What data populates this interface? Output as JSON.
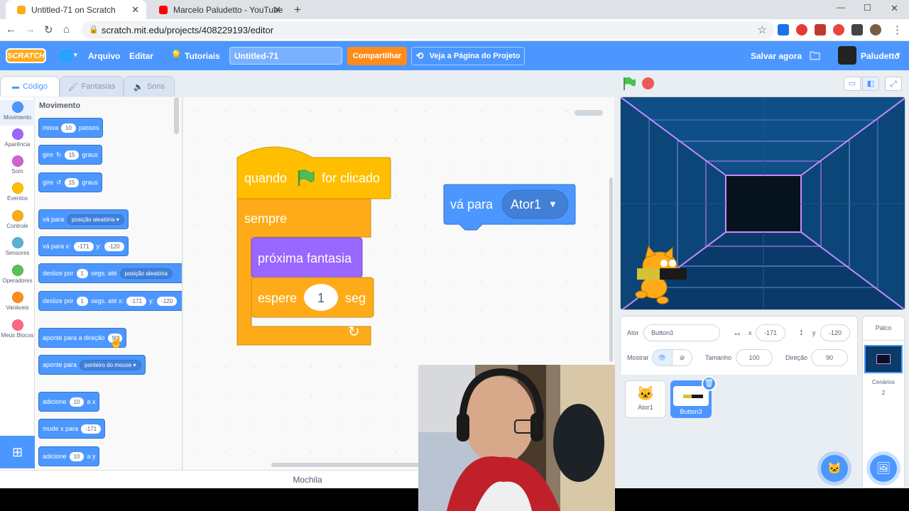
{
  "browser": {
    "tabs": [
      {
        "title": "Untitled-71 on Scratch",
        "active": true
      },
      {
        "title": "Marcelo Paludetto - YouTube",
        "active": false
      }
    ],
    "new_tab": "+",
    "url": "scratch.mit.edu/projects/408229193/editor",
    "window_controls": {
      "minimize": "—",
      "maximize": "☐",
      "close": "✕"
    }
  },
  "menubar": {
    "logo": "SCRATCH",
    "file": "Arquivo",
    "edit": "Editar",
    "tutorials": "Tutoriais",
    "project_title": "Untitled-71",
    "share": "Compartilhar",
    "see_project": "Veja a Página do Projeto",
    "save_now": "Salvar agora",
    "username": "Paludetto"
  },
  "editor_tabs": {
    "code": "Código",
    "costumes": "Fantasias",
    "sounds": "Sons"
  },
  "categories": [
    {
      "label": "Movimento",
      "color": "#4c97ff"
    },
    {
      "label": "Aparência",
      "color": "#9966ff"
    },
    {
      "label": "Som",
      "color": "#cf63cf"
    },
    {
      "label": "Eventos",
      "color": "#ffbf00"
    },
    {
      "label": "Controle",
      "color": "#ffab19"
    },
    {
      "label": "Sensores",
      "color": "#5cb1d6"
    },
    {
      "label": "Operadores",
      "color": "#59c059"
    },
    {
      "label": "Variáveis",
      "color": "#ff8c1a"
    },
    {
      "label": "Meus Blocos",
      "color": "#ff6680"
    }
  ],
  "palette": {
    "header": "Movimento",
    "blocks": {
      "move": {
        "a": "mova",
        "v": "10",
        "b": "passos"
      },
      "turn_right": {
        "a": "gire",
        "v": "15",
        "b": "graus"
      },
      "turn_left": {
        "a": "gire",
        "v": "15",
        "b": "graus"
      },
      "goto": {
        "a": "vá para",
        "dd": "posição aleatória"
      },
      "goto_xy": {
        "a": "vá para x:",
        "x": "-171",
        "y_label": "y:",
        "y": "-120"
      },
      "glide_to": {
        "a": "deslize por",
        "v": "1",
        "b": "segs. até",
        "dd": "posição aleatória"
      },
      "glide_xy": {
        "a": "deslize por",
        "v": "1",
        "b": "segs. até x:",
        "x": "-171",
        "y_label": "y:",
        "y": "-120"
      },
      "point_dir": {
        "a": "aponte para a direção",
        "v": "90"
      },
      "point_towards": {
        "a": "aponte para",
        "dd": "ponteiro do mouse"
      },
      "change_x": {
        "a": "adicione",
        "v": "10",
        "b": "a x"
      },
      "set_x": {
        "a": "mude x para",
        "v": "-171"
      },
      "change_y": {
        "a": "adicione",
        "v": "10",
        "b": "a y"
      }
    }
  },
  "workspace": {
    "hat": {
      "a": "quando",
      "b": "for clicado"
    },
    "forever": "sempre",
    "next_costume": "próxima fantasia",
    "wait": {
      "a": "espere",
      "v": "1",
      "b": "seg"
    },
    "goto_block": {
      "a": "vá para",
      "dd": "Ator1"
    }
  },
  "backpack": "Mochila",
  "sprite_info": {
    "sprite_label": "Ator",
    "sprite_name": "Button3",
    "x_label": "x",
    "x": "-171",
    "y_label": "y",
    "y": "-120",
    "show_label": "Mostrar",
    "size_label": "Tamanho",
    "size": "100",
    "direction_label": "Direção",
    "direction": "90"
  },
  "sprites": [
    {
      "name": "Ator1",
      "selected": false
    },
    {
      "name": "Button3",
      "selected": true
    }
  ],
  "stage_pane": {
    "title": "Palco",
    "backdrops_label": "Cenários",
    "backdrops_count": "2"
  },
  "colors": {
    "accent": "#4c97ff",
    "motion": "#4c97ff",
    "events": "#ffbf00",
    "control": "#ffab19",
    "looks": "#9966ff"
  }
}
